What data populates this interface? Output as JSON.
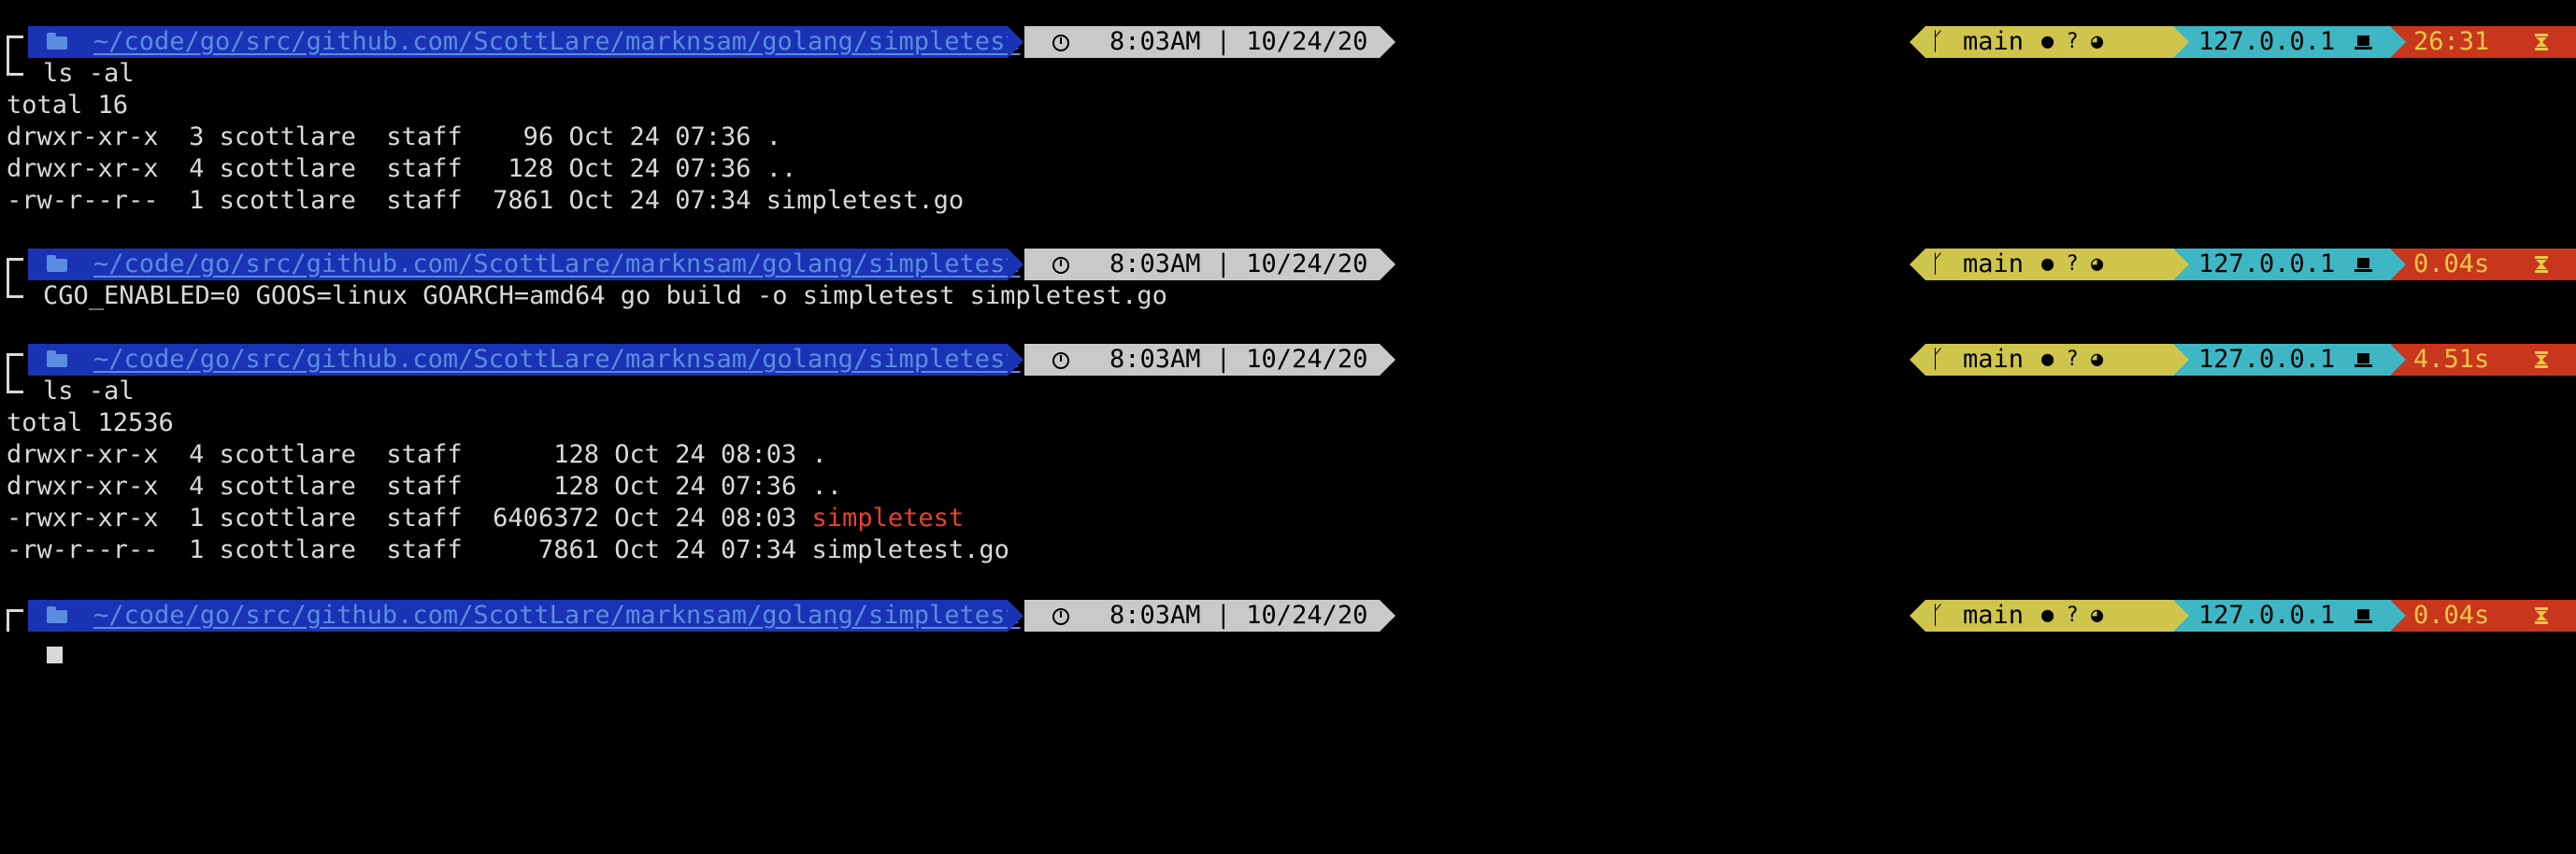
{
  "prompts": [
    {
      "path": "~/code/go/src/github.com/ScottLare/marknsam/golang/simpletest",
      "time": "8:03AM | 10/24/20",
      "branch": "main",
      "git_icons": "● ? ◕",
      "host": "127.0.0.1",
      "duration": "26:31",
      "command": "ls -al"
    },
    {
      "path": "~/code/go/src/github.com/ScottLare/marknsam/golang/simpletest",
      "time": "8:03AM | 10/24/20",
      "branch": "main",
      "git_icons": "● ? ◕",
      "host": "127.0.0.1",
      "duration": "0.04s",
      "command": "CGO_ENABLED=0 GOOS=linux GOARCH=amd64 go build -o simpletest simpletest.go"
    },
    {
      "path": "~/code/go/src/github.com/ScottLare/marknsam/golang/simpletest",
      "time": "8:03AM | 10/24/20",
      "branch": "main",
      "git_icons": "● ? ◕",
      "host": "127.0.0.1",
      "duration": "4.51s",
      "command": "ls -al"
    },
    {
      "path": "~/code/go/src/github.com/ScottLare/marknsam/golang/simpletest",
      "time": "8:03AM | 10/24/20",
      "branch": "main",
      "git_icons": "● ? ◕",
      "host": "127.0.0.1",
      "duration": "0.04s",
      "command": ""
    }
  ],
  "output1": [
    "total 16",
    "drwxr-xr-x  3 scottlare  staff    96 Oct 24 07:36 .",
    "drwxr-xr-x  4 scottlare  staff   128 Oct 24 07:36 ..",
    "-rw-r--r--  1 scottlare  staff  7861 Oct 24 07:34 simpletest.go"
  ],
  "output2": [
    "total 12536",
    "drwxr-xr-x  4 scottlare  staff      128 Oct 24 08:03 .",
    "drwxr-xr-x  4 scottlare  staff      128 Oct 24 07:36 ..",
    "-rwxr-xr-x  1 scottlare  staff  6406372 Oct 24 08:03 ",
    "-rw-r--r--  1 scottlare  staff     7861 Oct 24 07:34 simpletest.go"
  ],
  "exec_file": "simpletest",
  "colors": {
    "path_bg": "#1a33b5",
    "time_bg": "#c9c9c9",
    "git_bg": "#cfc54c",
    "host_bg": "#3fb6c3",
    "duration_bg": "#c8361d",
    "exec_fg": "#ef3f31"
  },
  "icons": [
    "folder-icon",
    "clock-icon",
    "branch-icon",
    "hourglass-icon",
    "computer-icon"
  ]
}
